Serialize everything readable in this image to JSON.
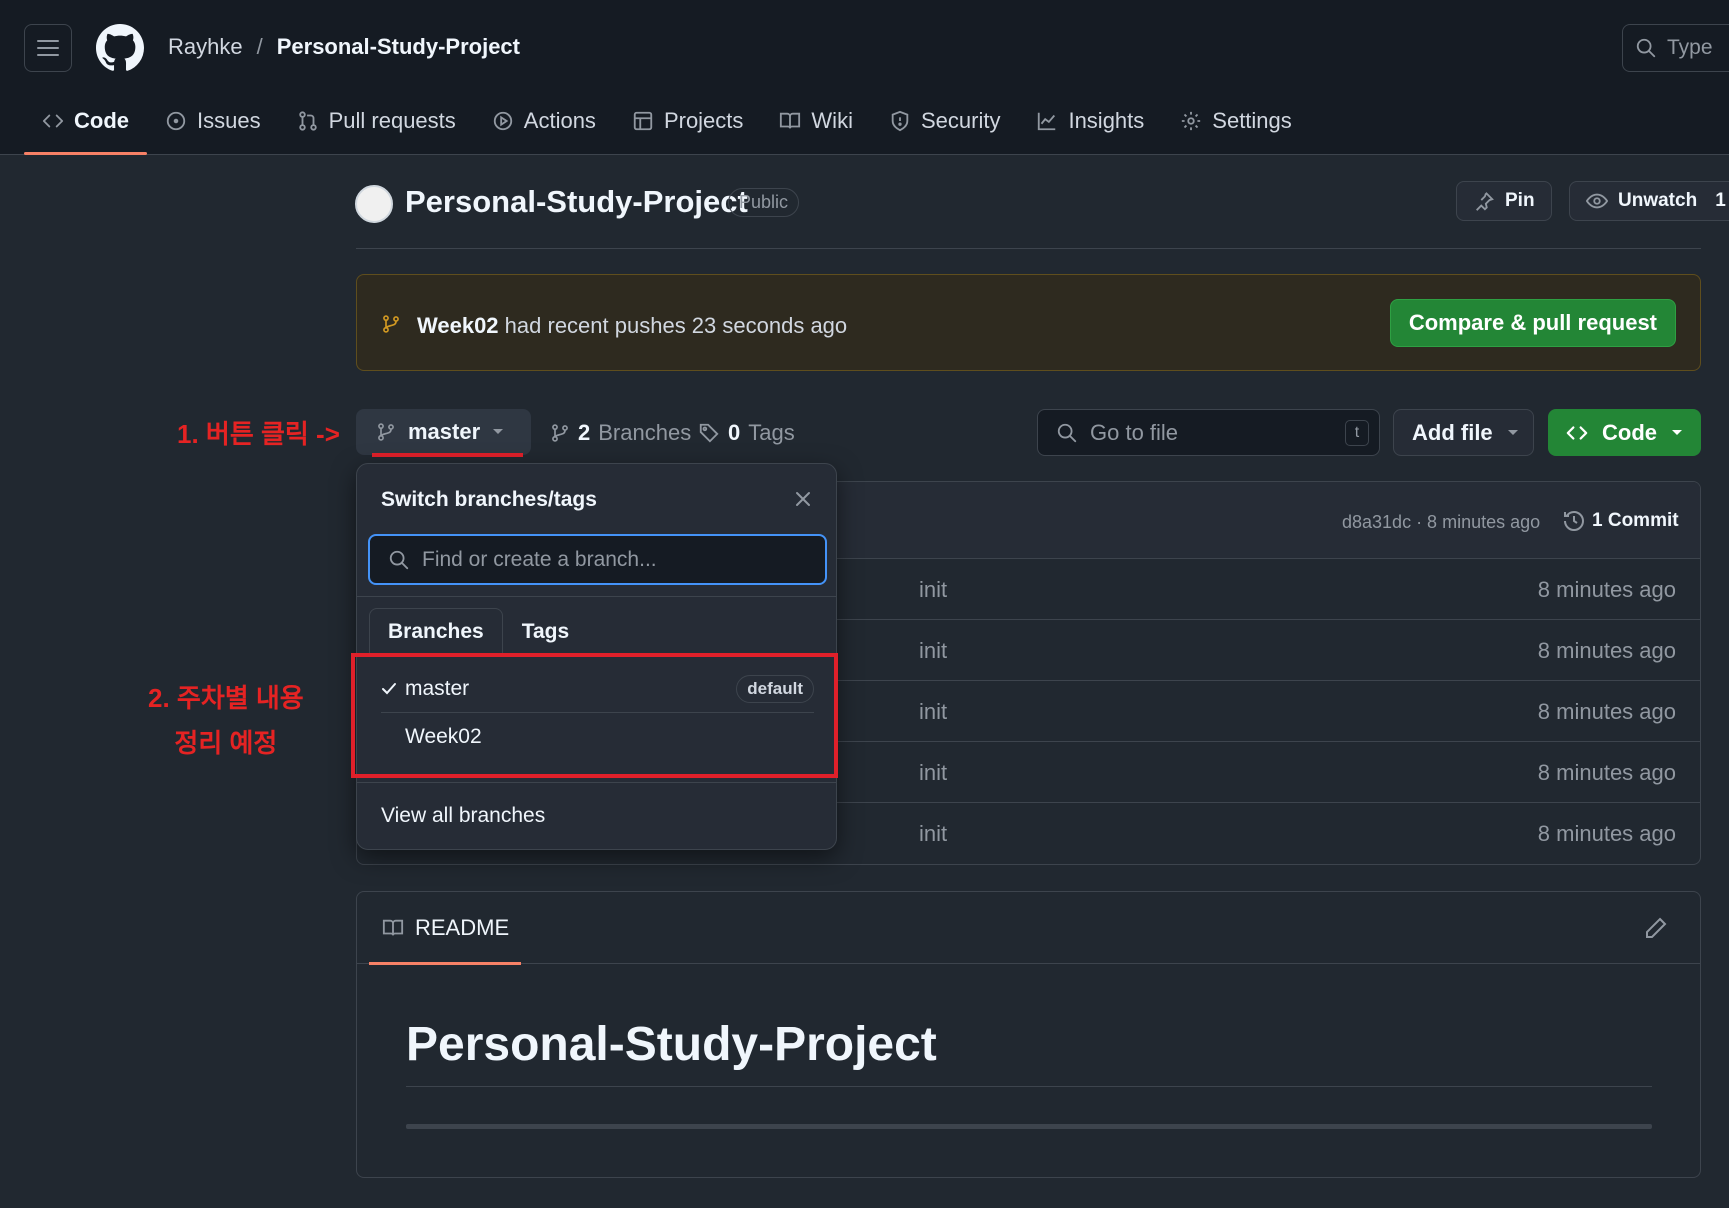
{
  "header": {
    "owner": "Rayhke",
    "separator": "/",
    "repo": "Personal-Study-Project",
    "search_placeholder": "Type"
  },
  "tabs": [
    {
      "label": "Code",
      "icon": "code-icon",
      "active": true
    },
    {
      "label": "Issues",
      "icon": "issue-icon"
    },
    {
      "label": "Pull requests",
      "icon": "pull-request-icon"
    },
    {
      "label": "Actions",
      "icon": "play-icon"
    },
    {
      "label": "Projects",
      "icon": "table-icon"
    },
    {
      "label": "Wiki",
      "icon": "book-icon"
    },
    {
      "label": "Security",
      "icon": "shield-icon"
    },
    {
      "label": "Insights",
      "icon": "graph-icon"
    },
    {
      "label": "Settings",
      "icon": "gear-icon"
    }
  ],
  "repo": {
    "title": "Personal-Study-Project",
    "visibility": "Public",
    "pin_label": "Pin",
    "unwatch_label": "Unwatch",
    "watch_count": "1"
  },
  "banner": {
    "branch": "Week02",
    "message": "had recent pushes 23 seconds ago",
    "compare_label": "Compare & pull request"
  },
  "branch_bar": {
    "current_branch": "master",
    "branches_count": "2",
    "branches_label": "Branches",
    "tags_count": "0",
    "tags_label": "Tags",
    "goto_placeholder": "Go to file",
    "goto_shortcut": "t",
    "add_file_label": "Add file",
    "code_label": "Code"
  },
  "annotations": {
    "step1": "1. 버튼 클릭 ->",
    "step2_line1": "2. 주차별 내용",
    "step2_line2": "정리 예정"
  },
  "commit": {
    "meta": "d8a31dc · 8 minutes ago",
    "count_label": "1 Commit"
  },
  "files": [
    {
      "message": "init",
      "time": "8 minutes ago"
    },
    {
      "message": "init",
      "time": "8 minutes ago"
    },
    {
      "message": "init",
      "time": "8 minutes ago"
    },
    {
      "message": "init",
      "time": "8 minutes ago"
    },
    {
      "message": "init",
      "time": "8 minutes ago"
    }
  ],
  "dropdown": {
    "title": "Switch branches/tags",
    "input_placeholder": "Find or create a branch...",
    "tab_branches": "Branches",
    "tab_tags": "Tags",
    "branches": [
      {
        "name": "master",
        "selected": true,
        "badge": "default"
      },
      {
        "name": "Week02",
        "selected": false
      }
    ],
    "view_all": "View all branches"
  },
  "readme": {
    "tab_label": "README",
    "heading": "Personal-Study-Project"
  },
  "colors": {
    "background": "#212830",
    "header": "#151b23",
    "accent_tab": "#f78166",
    "green": "#238636",
    "annotation_red": "#e52323",
    "focus_blue": "#4493f8"
  }
}
